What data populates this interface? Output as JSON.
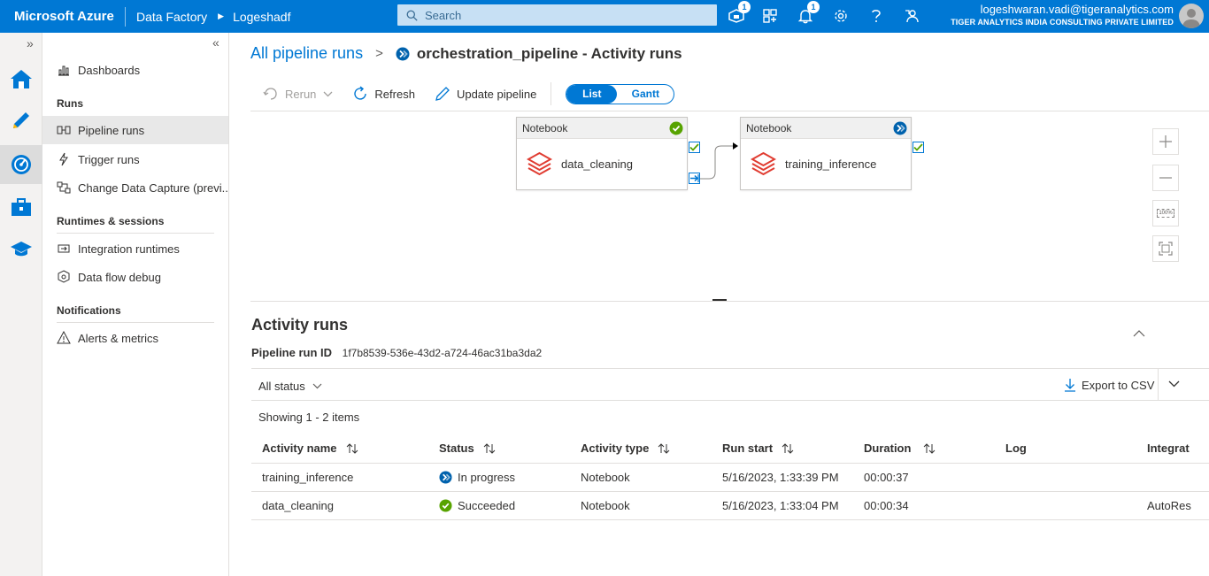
{
  "colors": {
    "accent": "#0078d4",
    "success": "#57a300",
    "databricks": "#e03c31"
  },
  "topbar": {
    "brand": "Microsoft Azure",
    "service": "Data Factory",
    "factory": "Logeshadf",
    "search_placeholder": "Search",
    "notifications_badge_feedback": "1",
    "notifications_badge_bell": "1",
    "user_email": "logeshwaran.vadi@tigeranalytics.com",
    "user_org": "TIGER ANALYTICS INDIA CONSULTING PRIVATE LIMITED",
    "icons": [
      "cloud-shell-icon",
      "directory-icon",
      "bell-icon",
      "gear-icon",
      "help-icon",
      "feedback-icon"
    ]
  },
  "rail": {
    "expand_glyph": "»",
    "items": [
      "home-icon",
      "author-pencil-icon",
      "monitor-icon",
      "manage-toolbox-icon",
      "learning-hat-icon"
    ],
    "active": "monitor-icon"
  },
  "nav": {
    "collapse_glyph": "«",
    "dashboards": "Dashboards",
    "runs_header": "Runs",
    "pipeline_runs": "Pipeline runs",
    "trigger_runs": "Trigger runs",
    "change_data_capture": "Change Data Capture (previ...",
    "runtimes_header": "Runtimes & sessions",
    "integration_runtimes": "Integration runtimes",
    "data_flow_debug": "Data flow debug",
    "notifications_header": "Notifications",
    "alerts_metrics": "Alerts & metrics"
  },
  "page": {
    "breadcrumb_link": "All pipeline runs",
    "breadcrumb_sep": ">",
    "title": "orchestration_pipeline - Activity runs"
  },
  "toolbar": {
    "rerun": "Rerun",
    "refresh": "Refresh",
    "update_pipeline": "Update pipeline",
    "view_list": "List",
    "view_gantt": "Gantt",
    "selected_view": "List"
  },
  "canvas": {
    "nodes": [
      {
        "type_label": "Notebook",
        "name": "data_cleaning",
        "status": "succeeded"
      },
      {
        "type_label": "Notebook",
        "name": "training_inference",
        "status": "in-progress"
      }
    ],
    "zoom_controls": [
      "zoom-in-icon",
      "zoom-out-icon",
      "zoom-100-icon",
      "fit-to-screen-icon"
    ],
    "zoom_100_label": "100%"
  },
  "activity_runs": {
    "title": "Activity runs",
    "run_id_label": "Pipeline run ID",
    "run_id": "1f7b8539-536e-43d2-a724-46ac31ba3da2",
    "status_filter": "All status",
    "export": "Export to CSV",
    "showing": "Showing 1 - 2 items",
    "columns": [
      "Activity name",
      "Status",
      "Activity type",
      "Run start",
      "Duration",
      "Log",
      "Integrat"
    ],
    "rows": [
      {
        "name": "training_inference",
        "status": "In progress",
        "status_kind": "in-progress",
        "type": "Notebook",
        "run_start": "5/16/2023, 1:33:39 PM",
        "duration": "00:00:37",
        "log": "",
        "integration": ""
      },
      {
        "name": "data_cleaning",
        "status": "Succeeded",
        "status_kind": "succeeded",
        "type": "Notebook",
        "run_start": "5/16/2023, 1:33:04 PM",
        "duration": "00:00:34",
        "log": "",
        "integration": "AutoRes"
      }
    ]
  }
}
